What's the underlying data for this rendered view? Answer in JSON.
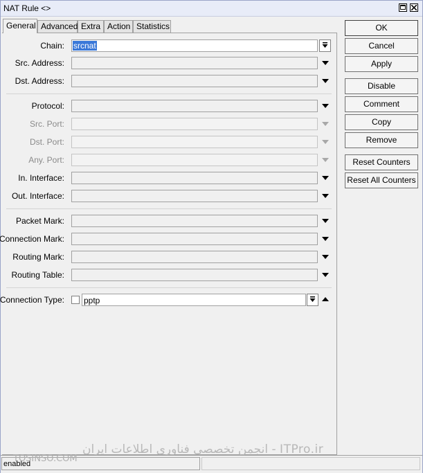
{
  "window": {
    "title": "NAT Rule <>"
  },
  "tabs": [
    {
      "label": "General",
      "active": true
    },
    {
      "label": "Advanced"
    },
    {
      "label": "Extra"
    },
    {
      "label": "Action"
    },
    {
      "label": "Statistics"
    }
  ],
  "form": {
    "chain": {
      "label": "Chain:",
      "value": "srcnat"
    },
    "src_address": {
      "label": "Src. Address:",
      "value": ""
    },
    "dst_address": {
      "label": "Dst. Address:",
      "value": ""
    },
    "protocol": {
      "label": "Protocol:",
      "value": ""
    },
    "src_port": {
      "label": "Src. Port:",
      "value": ""
    },
    "dst_port": {
      "label": "Dst. Port:",
      "value": ""
    },
    "any_port": {
      "label": "Any. Port:",
      "value": ""
    },
    "in_interface": {
      "label": "In. Interface:",
      "value": ""
    },
    "out_interface": {
      "label": "Out. Interface:",
      "value": ""
    },
    "packet_mark": {
      "label": "Packet Mark:",
      "value": ""
    },
    "connection_mark": {
      "label": "Connection Mark:",
      "value": ""
    },
    "routing_mark": {
      "label": "Routing Mark:",
      "value": ""
    },
    "routing_table": {
      "label": "Routing Table:",
      "value": ""
    },
    "connection_type": {
      "label": "Connection Type:",
      "value": "pptp",
      "negated": false
    }
  },
  "buttons": {
    "ok": "OK",
    "cancel": "Cancel",
    "apply": "Apply",
    "disable": "Disable",
    "comment": "Comment",
    "copy": "Copy",
    "remove": "Remove",
    "reset_counters": "Reset Counters",
    "reset_all_counters": "Reset All Counters"
  },
  "status": {
    "text": "enabled"
  },
  "watermark": {
    "main": "انجمن تخصصی فناوری اطلاعات ایران - ITPro.ir",
    "secondary": "TOSINSO.COM"
  },
  "colors": {
    "selection": "#3a78d8",
    "titlebar": "#e8ecf8"
  }
}
